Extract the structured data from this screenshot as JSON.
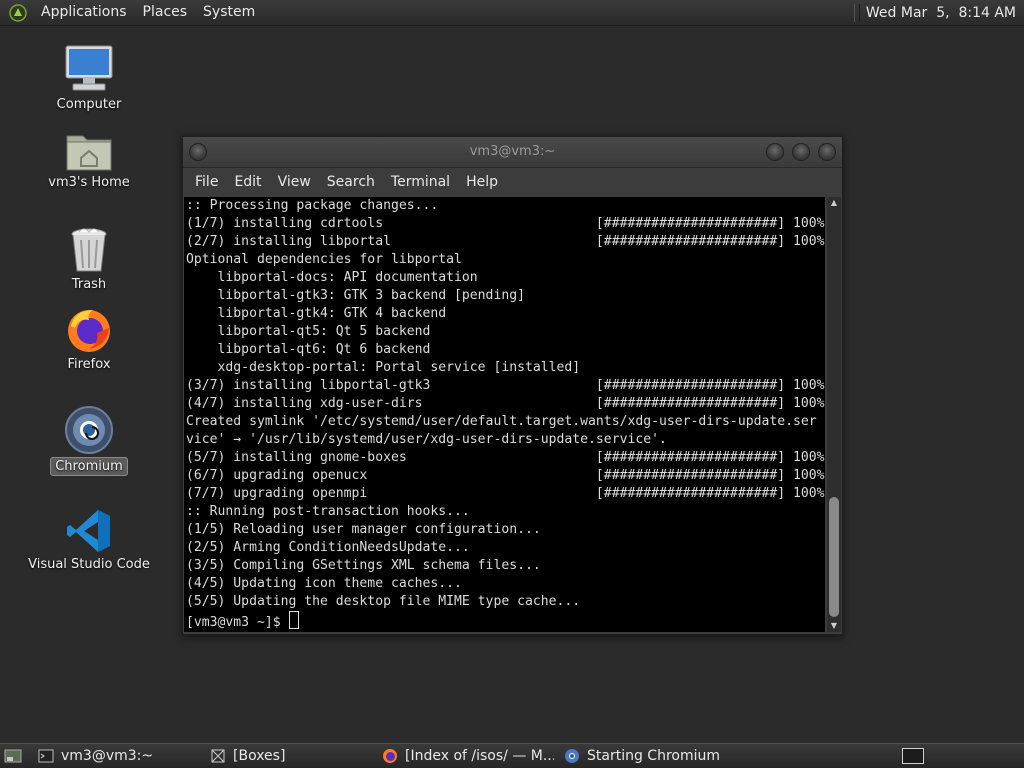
{
  "top_panel": {
    "menus": [
      "Applications",
      "Places",
      "System"
    ],
    "clock": "Wed Mar  5,  8:14 AM"
  },
  "desktop_icons": [
    {
      "label": "Computer",
      "icon": "computer-icon"
    },
    {
      "label": "vm3's Home",
      "icon": "home-folder-icon"
    },
    {
      "label": "Trash",
      "icon": "trash-icon"
    },
    {
      "label": "Firefox",
      "icon": "firefox-icon"
    },
    {
      "label": "Chromium",
      "icon": "chromium-icon",
      "selected": true
    },
    {
      "label": "Visual Studio Code",
      "icon": "vscode-icon"
    }
  ],
  "terminal": {
    "title": "vm3@vm3:~",
    "menu": [
      "File",
      "Edit",
      "View",
      "Search",
      "Terminal",
      "Help"
    ],
    "lines": [
      ":: Processing package changes...",
      "(1/7) installing cdrtools                           [######################] 100%",
      "(2/7) installing libportal                          [######################] 100%",
      "Optional dependencies for libportal",
      "    libportal-docs: API documentation",
      "    libportal-gtk3: GTK 3 backend [pending]",
      "    libportal-gtk4: GTK 4 backend",
      "    libportal-qt5: Qt 5 backend",
      "    libportal-qt6: Qt 6 backend",
      "    xdg-desktop-portal: Portal service [installed]",
      "(3/7) installing libportal-gtk3                     [######################] 100%",
      "(4/7) installing xdg-user-dirs                      [######################] 100%",
      "Created symlink '/etc/systemd/user/default.target.wants/xdg-user-dirs-update.ser",
      "vice' → '/usr/lib/systemd/user/xdg-user-dirs-update.service'.",
      "(5/7) installing gnome-boxes                        [######################] 100%",
      "(6/7) upgrading openucx                             [######################] 100%",
      "(7/7) upgrading openmpi                             [######################] 100%",
      ":: Running post-transaction hooks...",
      "(1/5) Reloading user manager configuration...",
      "(2/5) Arming ConditionNeedsUpdate...",
      "(3/5) Compiling GSettings XML schema files...",
      "(4/5) Updating icon theme caches...",
      "(5/5) Updating the desktop file MIME type cache..."
    ],
    "prompt": "[vm3@vm3 ~]$ "
  },
  "taskbar": {
    "tasks": [
      {
        "label": "vm3@vm3:~",
        "icon": "terminal-icon"
      },
      {
        "label": "[Boxes]",
        "icon": "boxes-icon"
      },
      {
        "label": "[Index of /isos/ — M...",
        "icon": "firefox-icon"
      },
      {
        "label": "Starting Chromium",
        "icon": "chromium-icon"
      }
    ]
  },
  "colors": {
    "desktop_bg": "#2b2b2b",
    "terminal_bg": "#000000",
    "terminal_fg": "#dcdcdc"
  }
}
